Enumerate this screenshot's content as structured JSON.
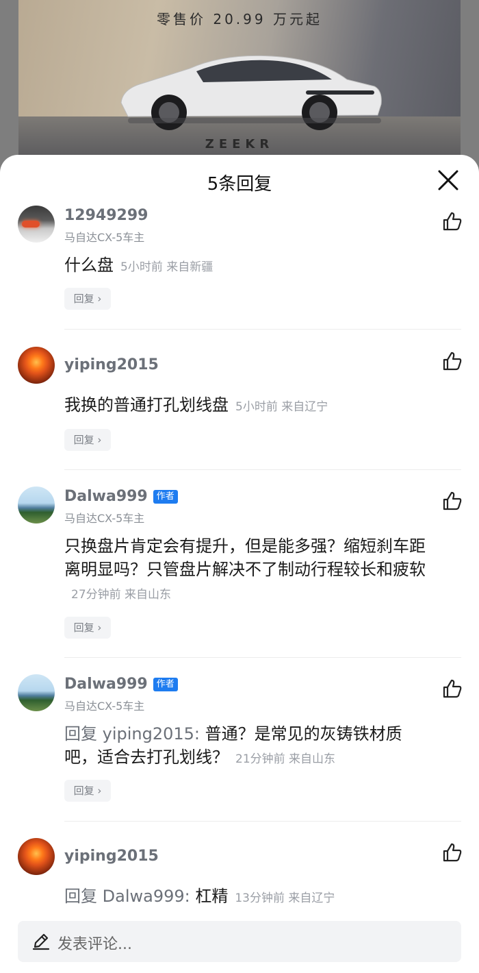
{
  "ad": {
    "price": "零售价 20.99 万元起",
    "brand": "ZEEKR"
  },
  "sheet": {
    "title": "5条回复"
  },
  "comments": [
    {
      "user": "12949299",
      "badge": "",
      "subtitle": "马自达CX-5车主",
      "reply_to": "",
      "text": "什么盘",
      "meta": "5小时前 来自新疆",
      "reply_label": "回复",
      "avatar": "car-taillight"
    },
    {
      "user": "yiping2015",
      "badge": "",
      "subtitle": "",
      "reply_to": "",
      "text": "我换的普通打孔划线盘",
      "meta": "5小时前 来自辽宁",
      "reply_label": "回复",
      "avatar": "sunset"
    },
    {
      "user": "Dalwa999",
      "badge": "作者",
      "subtitle": "马自达CX-5车主",
      "reply_to": "",
      "text": "只换盘片肯定会有提升，但是能多强？缩短刹车距离明显吗？只管盘片解决不了制动行程较长和疲软",
      "meta": "27分钟前 来自山东",
      "reply_label": "回复",
      "avatar": "coast"
    },
    {
      "user": "Dalwa999",
      "badge": "作者",
      "subtitle": "马自达CX-5车主",
      "reply_to": "回复 yiping2015:",
      "text": "普通？是常见的灰铸铁材质吧，适合去打孔划线？",
      "meta": "21分钟前 来自山东",
      "reply_label": "回复",
      "avatar": "coast"
    },
    {
      "user": "yiping2015",
      "badge": "",
      "subtitle": "",
      "reply_to": "回复 Dalwa999:",
      "text": "杠精",
      "meta": "13分钟前 来自辽宁",
      "reply_label": "",
      "avatar": "sunset"
    }
  ],
  "compose": {
    "placeholder": "发表评论..."
  },
  "colors": {
    "accent": "#1e7cf0",
    "username": "#6b7078",
    "meta": "#9a9ea5"
  }
}
